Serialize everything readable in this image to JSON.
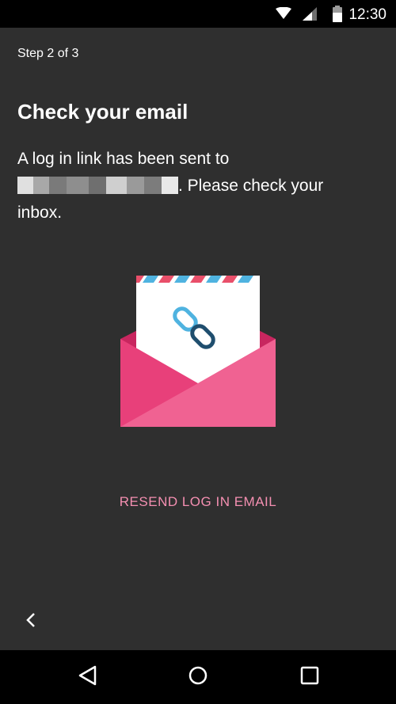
{
  "status_bar": {
    "time": "12:30",
    "icons": [
      "wifi-icon",
      "signal-icon",
      "battery-icon"
    ]
  },
  "onboarding": {
    "step": "Step 2 of 3",
    "title": "Check your email",
    "message_prefix": "A log in link has been sent to",
    "message_suffix": ". Please check your inbox.",
    "illustration": "envelope-with-link-icon",
    "resend_label": "RESEND LOG IN EMAIL",
    "back_icon": "chevron-left-icon"
  },
  "navigation_bar": {
    "buttons": [
      "nav-back-icon",
      "nav-home-icon",
      "nav-recents-icon"
    ]
  },
  "colors": {
    "background": "#2f2f2f",
    "accent": "#f48fb1",
    "envelope_pink": "#e8407a",
    "link_blue": "#4fb3e0",
    "link_dark": "#1f4e6e"
  }
}
